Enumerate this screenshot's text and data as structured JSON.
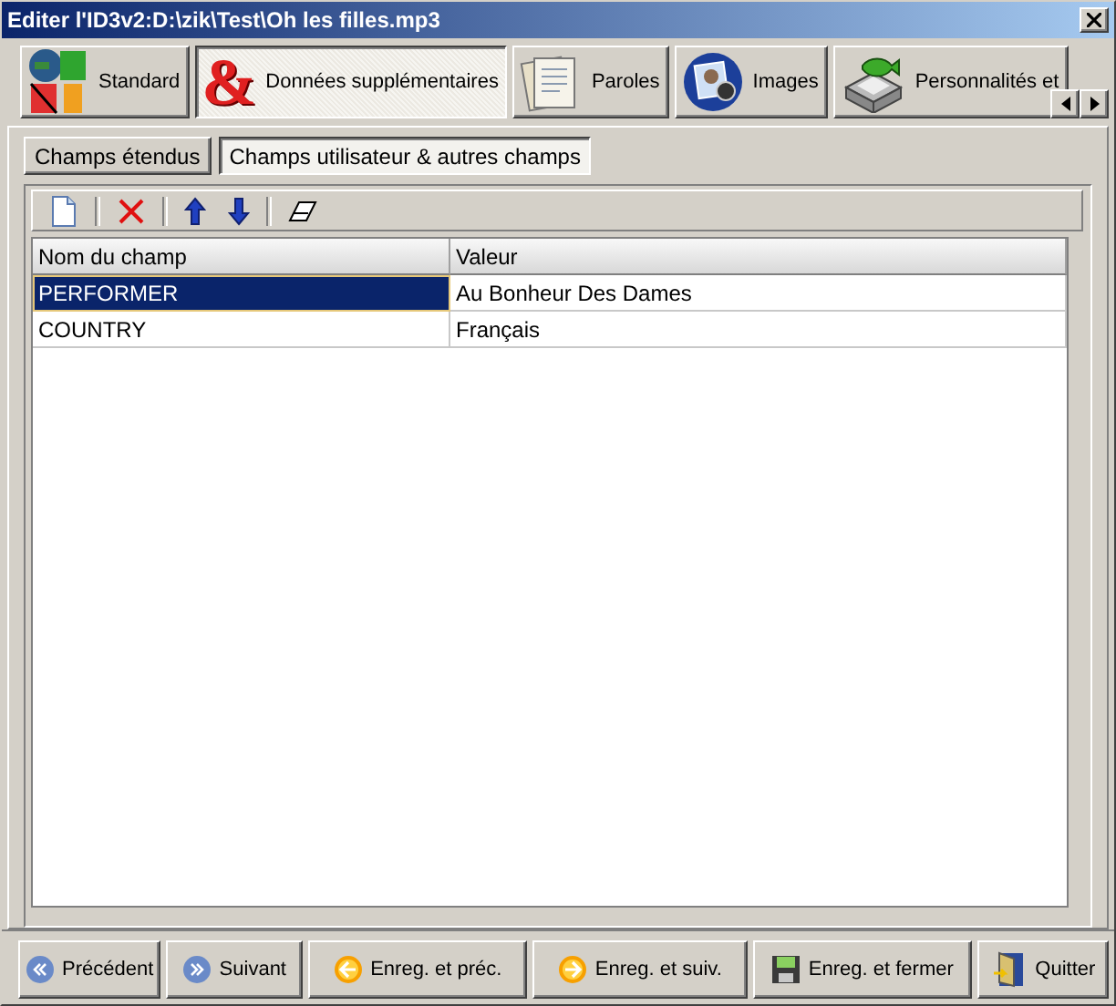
{
  "window": {
    "title": "Editer l'ID3v2:D:\\zik\\Test\\Oh les filles.mp3"
  },
  "tabs": [
    {
      "label": "Standard",
      "selected": false
    },
    {
      "label": "Données supplémentaires",
      "glyph": "&",
      "selected": true
    },
    {
      "label": "Paroles",
      "selected": false
    },
    {
      "label": "Images",
      "selected": false
    },
    {
      "label": "Personnalités et",
      "selected": false
    }
  ],
  "subtabs": [
    {
      "label": "Champs étendus",
      "selected": false
    },
    {
      "label": "Champs utilisateur & autres champs",
      "selected": true
    }
  ],
  "table": {
    "columns": [
      "Nom du champ",
      "Valeur"
    ],
    "rows": [
      {
        "cells": [
          "PERFORMER",
          "Au Bonheur Des Dames"
        ],
        "selected": true
      },
      {
        "cells": [
          "COUNTRY",
          "Français"
        ],
        "selected": false
      }
    ]
  },
  "buttons": [
    "Précédent",
    "Suivant",
    "Enreg. et préc.",
    "Enreg. et suiv.",
    "Enreg. et fermer",
    "Quitter"
  ]
}
